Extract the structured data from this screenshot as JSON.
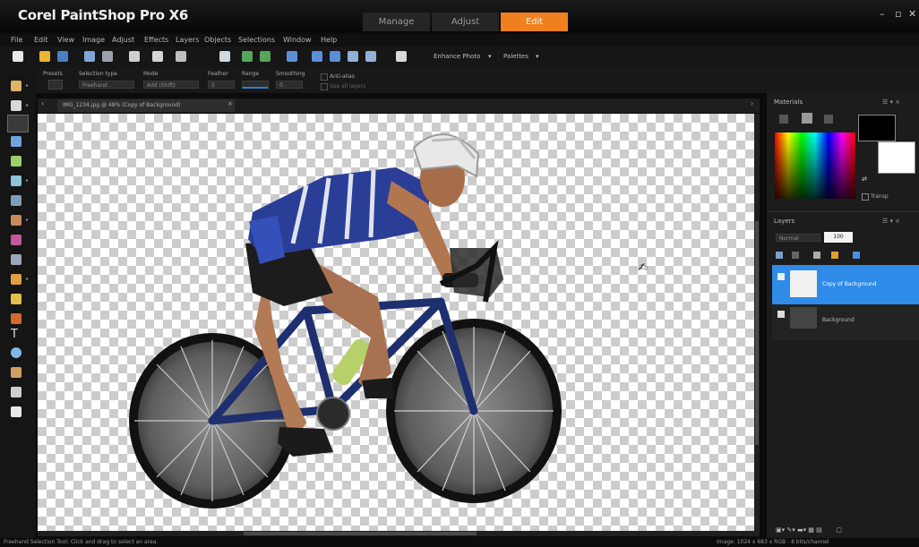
{
  "app": {
    "title": "Corel PaintShop Pro X6",
    "workspace_tabs": [
      {
        "label": "Manage",
        "active": false
      },
      {
        "label": "Adjust",
        "active": false
      },
      {
        "label": "Edit",
        "active": true
      }
    ],
    "accent_color": "#f07f1d"
  },
  "menus": [
    "File",
    "Edit",
    "View",
    "Image",
    "Adjust",
    "Effects",
    "Layers",
    "Objects",
    "Selections",
    "Window",
    "Help"
  ],
  "toolbar": {
    "enhance_photo_label": "Enhance Photo",
    "palettes_label": "Palettes"
  },
  "tool_options": {
    "presets_label": "Presets",
    "selection_type_label": "Selection type",
    "selection_type_value": "Freehand",
    "mode_label": "Mode",
    "mode_value": "Add (Shift)",
    "feather_label": "Feather",
    "feather_value": "0",
    "range_label": "Range",
    "smoothing_label": "Smoothing",
    "smoothing_value": "0",
    "antialias_label": "Anti-alias",
    "sample_merged_label": "Use all layers"
  },
  "document": {
    "tab_label": "IMG_1234.jpg @ 48% (Copy of Background)"
  },
  "materials_panel": {
    "title": "Materials",
    "transparent_label": "Transp"
  },
  "layers_panel": {
    "title": "Layers",
    "blend_mode": "Normal",
    "opacity": "100",
    "layers": [
      {
        "name": "Copy of Background",
        "selected": true
      },
      {
        "name": "Background",
        "selected": false
      }
    ]
  },
  "status": {
    "left": "Freehand Selection Tool: Click and drag to select an area.",
    "right": "Image: 1024 x 683 x RGB - 8 bits/channel"
  }
}
